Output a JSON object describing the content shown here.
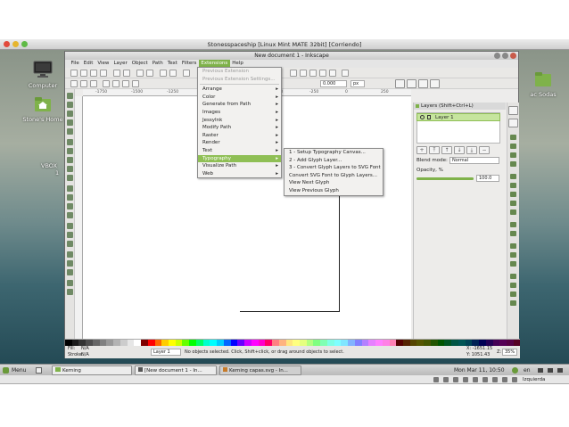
{
  "vm_title": "Stonesspaceship [Linux Mint MATE 32bit] [Corriendo]",
  "window_title": "New document 1 - Inkscape",
  "desktop_icons": {
    "computer": "Computer",
    "home": "Stone's Home",
    "vbox_label": "VBOX",
    "vbox_sub": "1",
    "right_label": "ac Sodas"
  },
  "menubar": [
    "File",
    "Edit",
    "View",
    "Layer",
    "Object",
    "Path",
    "Text",
    "Filters",
    "Extensions",
    "Help"
  ],
  "ext_menu": {
    "items": [
      {
        "label": "Previous Extension",
        "disabled": true
      },
      {
        "label": "Previous Extension Settings...",
        "disabled": true
      },
      {
        "label": "Arrange",
        "sub": true
      },
      {
        "label": "Color",
        "sub": true
      },
      {
        "label": "Generate from Path",
        "sub": true
      },
      {
        "label": "Images",
        "sub": true
      },
      {
        "label": "JessyInk",
        "sub": true
      },
      {
        "label": "Modify Path",
        "sub": true
      },
      {
        "label": "Raster",
        "sub": true
      },
      {
        "label": "Render",
        "sub": true
      },
      {
        "label": "Text",
        "sub": true
      },
      {
        "label": "Typography",
        "sub": true,
        "selected": true
      },
      {
        "label": "Visualize Path",
        "sub": true
      },
      {
        "label": "Web",
        "sub": true
      }
    ]
  },
  "typo_menu": [
    "1 - Setup Typography Canvas...",
    "2 - Add Glyph Layer...",
    "3 - Convert Glyph Layers to SVG Font",
    "Convert SVG Font to Glyph Layers...",
    "View Next Glyph",
    "View Previous Glyph"
  ],
  "toolbar": {
    "zoom_value": "0.000",
    "unit": "px"
  },
  "layers": {
    "title": "Layers (Shift+Ctrl+L)",
    "layer_name": "Layer 1",
    "blend_label": "Blend mode:",
    "blend_value": "Normal",
    "opacity_label": "Opacity, %",
    "opacity_value": "100.0",
    "opacity_level": 1.0
  },
  "ruler_marks": [
    "-1750",
    "-1500",
    "-1250",
    "-1000",
    "-750",
    "-500",
    "-250",
    "0",
    "250"
  ],
  "status": {
    "fill_label": "Fill:",
    "fill_value": "N/A",
    "stroke_label": "Stroke:",
    "stroke_value": "N/A",
    "layer": "Layer 1",
    "message": "No objects selected. Click, Shift+click, or drag around objects to select.",
    "x": "X: -1651.15",
    "y": "Y: 1051.43",
    "z_label": "Z:",
    "zoom": "35%"
  },
  "taskbar": {
    "menu": "Menu",
    "tasks": [
      "Kerning",
      "[New document 1 - In...",
      "Kerning capas.svg - In..."
    ],
    "clock": "Mon Mar 11, 10:50",
    "lang": "en"
  },
  "tray": {
    "keyboard": "Izquierda"
  },
  "palette_colors": [
    "#000000",
    "#1a1a1a",
    "#333333",
    "#4d4d4d",
    "#666666",
    "#808080",
    "#999999",
    "#b3b3b3",
    "#cccccc",
    "#e6e6e6",
    "#ffffff",
    "#800000",
    "#ff0000",
    "#ff6600",
    "#ffcc00",
    "#ffff00",
    "#ccff00",
    "#66ff00",
    "#00ff00",
    "#00ff66",
    "#00ffcc",
    "#00ffff",
    "#00ccff",
    "#0066ff",
    "#0000ff",
    "#6600ff",
    "#cc00ff",
    "#ff00ff",
    "#ff00cc",
    "#ff0066",
    "#ff8080",
    "#ffb380",
    "#ffe680",
    "#ffff80",
    "#e6ff80",
    "#b3ff80",
    "#80ff80",
    "#80ffb3",
    "#80ffe6",
    "#80ffff",
    "#80e6ff",
    "#80b3ff",
    "#8080ff",
    "#b380ff",
    "#e680ff",
    "#ff80ff",
    "#ff80e6",
    "#ff80b3",
    "#550000",
    "#552200",
    "#554400",
    "#555500",
    "#445500",
    "#225500",
    "#005500",
    "#005522",
    "#005544",
    "#005555",
    "#004455",
    "#002255",
    "#000055",
    "#220055",
    "#440055",
    "#550055",
    "#550044",
    "#550022"
  ]
}
